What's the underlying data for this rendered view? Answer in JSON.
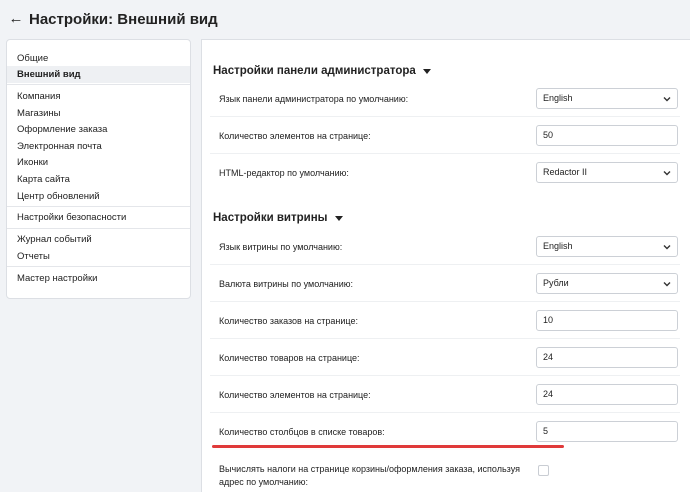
{
  "header": {
    "back_icon": "arrow-left-icon",
    "title": "Настройки: Внешний вид"
  },
  "sidebar": {
    "items": [
      {
        "label": "Общие",
        "active": false
      },
      {
        "label": "Внешний вид",
        "active": true
      },
      {
        "label": "Компания",
        "active": false
      },
      {
        "label": "Магазины",
        "active": false
      },
      {
        "label": "Оформление заказа",
        "active": false
      },
      {
        "label": "Электронная почта",
        "active": false
      },
      {
        "label": "Иконки",
        "active": false
      },
      {
        "label": "Карта сайта",
        "active": false
      },
      {
        "label": "Центр обновлений",
        "active": false
      },
      {
        "label": "Настройки безопасности",
        "active": false
      },
      {
        "label": "Журнал событий",
        "active": false
      },
      {
        "label": "Отчеты",
        "active": false
      },
      {
        "label": "Мастер настройки",
        "active": false
      }
    ]
  },
  "admin_section": {
    "title": "Настройки панели администратора",
    "rows": [
      {
        "label": "Язык панели администратора по умолчанию:",
        "type": "select",
        "value": "English"
      },
      {
        "label": "Количество элементов на странице:",
        "type": "input",
        "value": "50"
      },
      {
        "label": "HTML-редактор по умолчанию:",
        "type": "select",
        "value": "Redactor II"
      }
    ]
  },
  "storefront_section": {
    "title": "Настройки витрины",
    "rows": [
      {
        "label": "Язык витрины по умолчанию:",
        "type": "select",
        "value": "English"
      },
      {
        "label": "Валюта витрины по умолчанию:",
        "type": "select",
        "value": "Рубли"
      },
      {
        "label": "Количество заказов на странице:",
        "type": "input",
        "value": "10"
      },
      {
        "label": "Количество товаров на странице:",
        "type": "input",
        "value": "24"
      },
      {
        "label": "Количество элементов на странице:",
        "type": "input",
        "value": "24"
      },
      {
        "label": "Количество столбцов в списке товаров:",
        "type": "input",
        "value": "5"
      },
      {
        "label_line1": "Вычислять налоги на странице корзины/оформления заказа, используя",
        "label_line2": "адрес по умолчанию:",
        "type": "checkbox",
        "checked": false
      }
    ]
  },
  "colors": {
    "accent_highlight": "#e03a3a",
    "active_item_bg": "#eef0f3",
    "page_bg": "#f1f3f6"
  }
}
